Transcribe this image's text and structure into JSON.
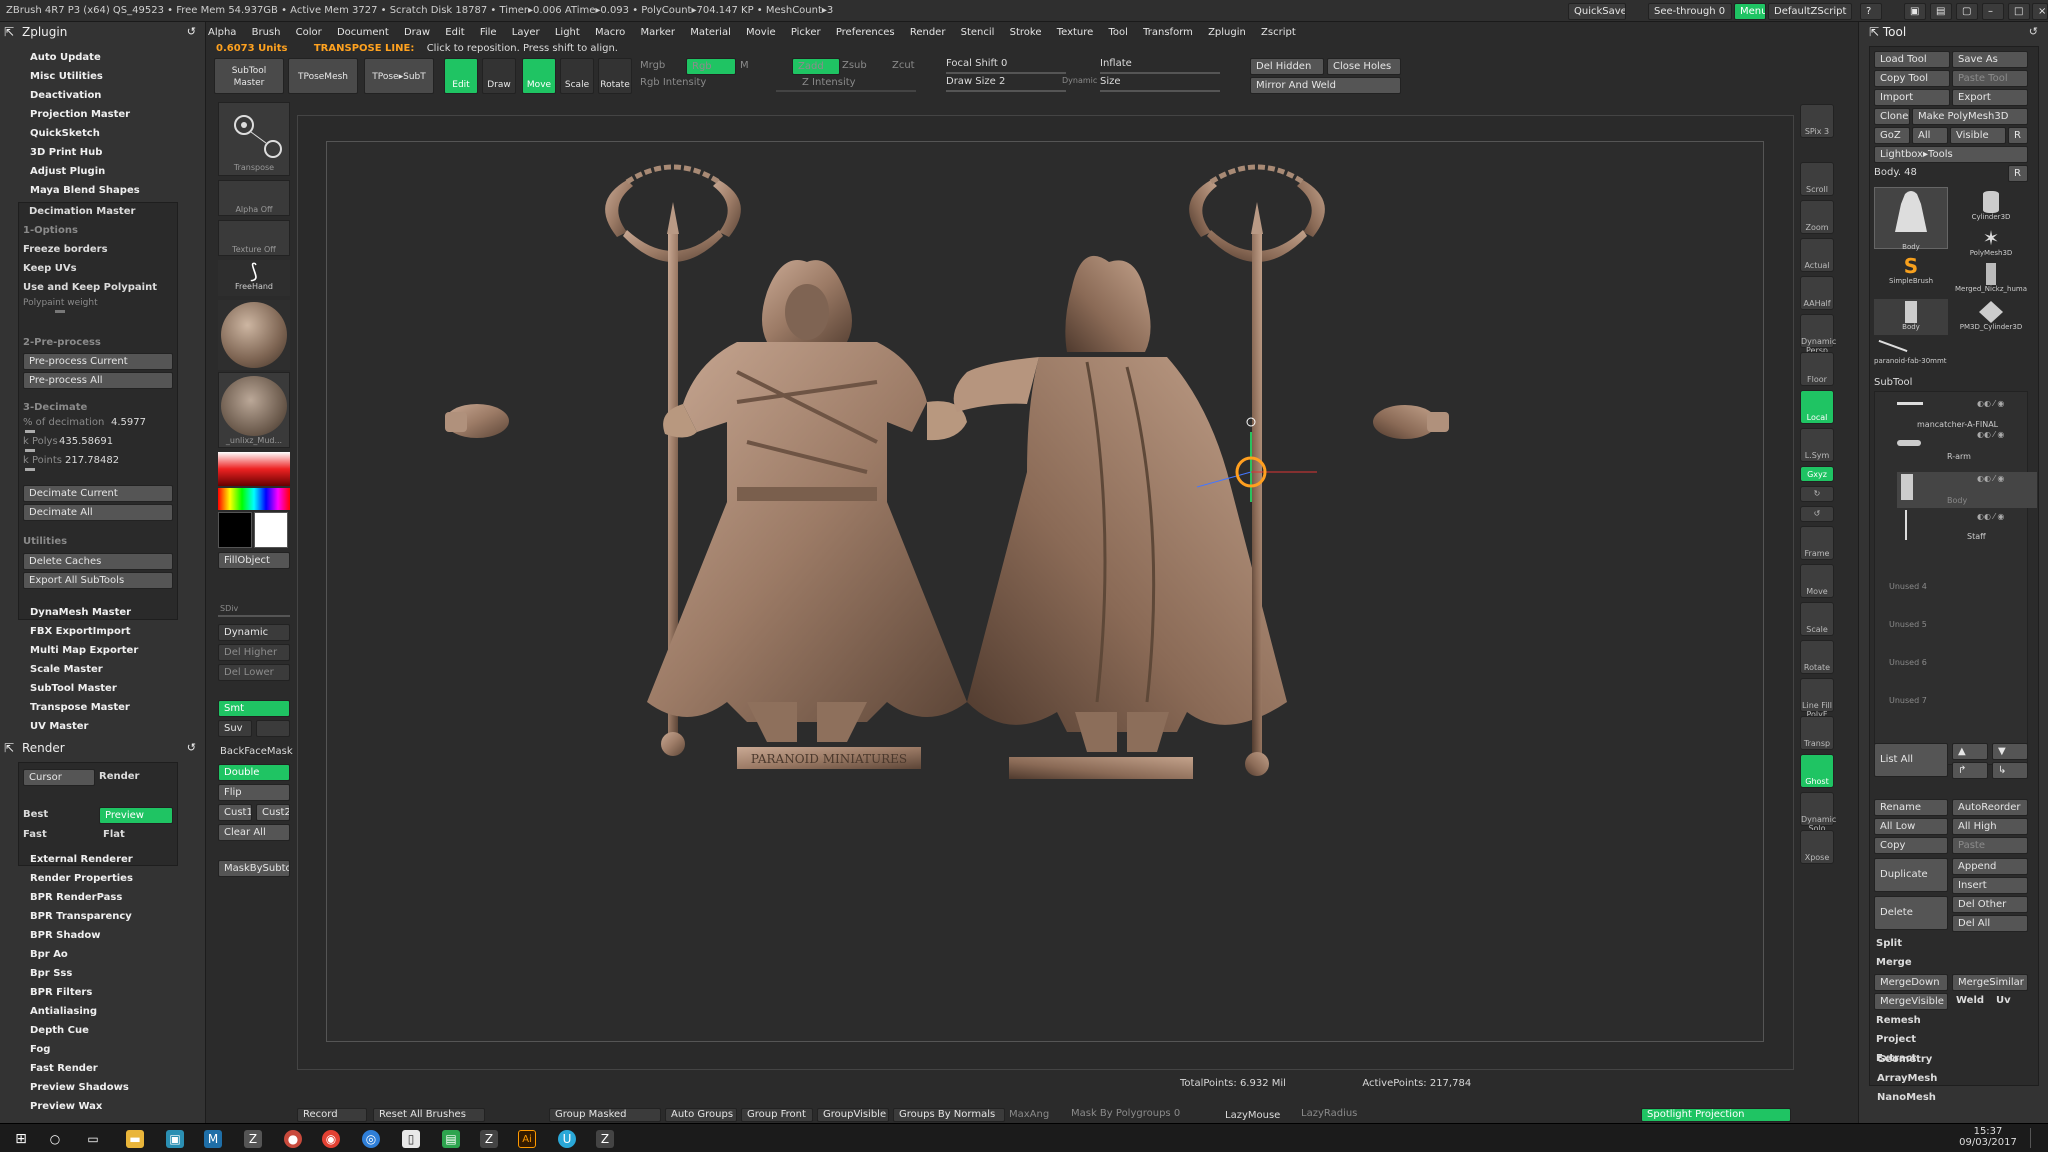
{
  "titlebar": {
    "text": "ZBrush 4R7 P3 (x64)   QS_49523   • Free Mem 54.937GB • Active Mem 3727 • Scratch Disk 18787 • Timer▸0.006 ATime▸0.093 • PolyCount▸704.147 KP • MeshCount▸3",
    "quicksave": "QuickSave",
    "seethrough": "See-through  0",
    "menus": "Menus",
    "defaultzscript": "DefaultZScript"
  },
  "menubar": [
    "Alpha",
    "Brush",
    "Color",
    "Document",
    "Draw",
    "Edit",
    "File",
    "Layer",
    "Light",
    "Macro",
    "Marker",
    "Material",
    "Movie",
    "Picker",
    "Preferences",
    "Render",
    "Stencil",
    "Stroke",
    "Texture",
    "Tool",
    "Transform",
    "Zplugin",
    "Zscript"
  ],
  "status": {
    "units": "0.6073 Units",
    "mode": "TRANSPOSE LINE:",
    "message": "Click to reposition. Press shift to align."
  },
  "left_palette": {
    "title": "Zplugin",
    "items_top": [
      "Auto Update",
      "Misc Utilities",
      "Deactivation",
      "Projection Master",
      "QuickSketch",
      "3D Print Hub",
      "Adjust Plugin",
      "Maya Blend Shapes"
    ],
    "decimation": {
      "title": "Decimation Master",
      "options_label": "1-Options",
      "options": [
        "Freeze borders",
        "Keep UVs",
        "Use and Keep Polypaint"
      ],
      "polypaint_weight": "Polypaint weight",
      "preprocess_label": "2-Pre-process",
      "preprocess_current": "Pre-process Current",
      "preprocess_all": "Pre-process All",
      "decimate_label": "3-Decimate",
      "pct_label": "% of decimation",
      "pct_value": "4.5977",
      "kpolys_label": "k Polys",
      "kpolys_value": "435.58691",
      "kpoints_label": "k Points",
      "kpoints_value": "217.78482",
      "decimate_current": "Decimate Current",
      "decimate_all": "Decimate All",
      "utilities_label": "Utilities",
      "delete_caches": "Delete Caches",
      "export_all": "Export All SubTools"
    },
    "items_bottom": [
      "DynaMesh Master",
      "FBX ExportImport",
      "Multi Map Exporter",
      "Scale Master",
      "SubTool Master",
      "Transpose Master",
      "UV Master"
    ],
    "render_title": "Render",
    "render_panel": {
      "cursor": "Cursor",
      "render": "Render",
      "best": "Best",
      "preview": "Preview",
      "fast": "Fast",
      "flat": "Flat"
    },
    "render_items": [
      "External Renderer",
      "Render Properties",
      "BPR RenderPass",
      "BPR Transparency",
      "BPR Shadow",
      "Bpr Ao",
      "Bpr Sss",
      "BPR Filters",
      "Antialiasing",
      "Depth Cue",
      "Fog",
      "Fast Render",
      "Preview Shadows",
      "Preview Wax"
    ]
  },
  "toolstrip": {
    "subtool_master": "SubTool Master",
    "tpose_mesh": "TPoseMesh",
    "tpose_subt": "TPose▸SubT",
    "edit": "Edit",
    "draw": "Draw",
    "move": "Move",
    "scale": "Scale",
    "rotate": "Rotate",
    "mrgb": "Mrgb",
    "rgb": "Rgb",
    "m": "M",
    "rgb_intensity": "Rgb Intensity",
    "zadd": "Zadd",
    "zsub": "Zsub",
    "zcut": "Zcut",
    "z_intensity": "Z Intensity",
    "focal_shift": "Focal Shift 0",
    "draw_size": "Draw Size 2",
    "dynamic": "Dynamic",
    "inflate": "Inflate",
    "size": "Size",
    "del_hidden": "Del Hidden",
    "close_holes": "Close Holes",
    "mirror_weld": "Mirror And Weld"
  },
  "shelf": {
    "transpose": "Transpose",
    "alpha_off": "Alpha Off",
    "texture_off": "Texture Off",
    "freehand": "FreeHand",
    "material": "_unlixz_Mud...",
    "fillobject": "FillObject",
    "sdiv": "SDiv",
    "dynamic": "Dynamic",
    "del_higher": "Del Higher",
    "del_lower": "Del Lower",
    "smt": "Smt",
    "suv": "Suv",
    "backfacemask": "BackFaceMask",
    "double": "Double",
    "flip": "Flip",
    "cust1": "Cust1",
    "cust2": "Cust2",
    "clear_all": "Clear All",
    "maskbysubtool": "MaskBySubtool"
  },
  "viewport": {
    "base_text": "PARANOID MINIATURES",
    "total_points": "TotalPoints: 6.932 Mil",
    "active_points": "ActivePoints: 217,784"
  },
  "right_shelf": [
    "SPix 3",
    "Scroll",
    "Zoom",
    "Actual",
    "AAHalf",
    "Dynamic Persp",
    "Floor",
    "Local",
    "L.Sym",
    "Gxyz",
    "",
    "",
    "Frame",
    "Move",
    "Scale",
    "Rotate",
    "Line Fill PolyF",
    "Transp",
    "Ghost",
    "Dynamic Solo",
    "Xpose"
  ],
  "right_palette": {
    "title": "Tool",
    "load_tool": "Load Tool",
    "save_as": "Save As",
    "copy_tool": "Copy Tool",
    "paste_tool": "Paste Tool",
    "import": "Import",
    "export": "Export",
    "clone": "Clone",
    "make_polymesh": "Make PolyMesh3D",
    "goz": "GoZ",
    "all": "All",
    "visible": "Visible",
    "r": "R",
    "lightbox_tools": "Lightbox▸Tools",
    "body_slider": "Body. 48",
    "thumbs": [
      "Body",
      "Cylinder3D",
      "PolyMesh3D",
      "SimpleBrush",
      "Merged_Nickz_huma",
      "Body",
      "PM3D_Cylinder3D",
      "paranoid-fab-30mmt"
    ],
    "subtool_title": "SubTool",
    "subtools": [
      "mancatcher-A-FINAL",
      "R-arm",
      "Body",
      "Staff"
    ],
    "unused": [
      "Unused 4",
      "Unused 5",
      "Unused 6",
      "Unused 7"
    ],
    "list_all": "List All",
    "rename": "Rename",
    "autoreorder": "AutoReorder",
    "all_low": "All Low",
    "all_high": "All High",
    "copy": "Copy",
    "paste": "Paste",
    "duplicate": "Duplicate",
    "append": "Append",
    "insert": "Insert",
    "delete": "Delete",
    "del_other": "Del Other",
    "del_all": "Del All",
    "split": "Split",
    "merge": "Merge",
    "mergedown": "MergeDown",
    "mergesimilar": "MergeSimilar",
    "mergevisible": "MergeVisible",
    "weld": "Weld",
    "uv": "Uv",
    "remesh": "Remesh",
    "project": "Project",
    "extract": "Extract",
    "geometry": "Geometry",
    "arraymesh": "ArrayMesh",
    "nanomesh": "NanoMesh"
  },
  "bottombar": {
    "record": "Record",
    "reset_brushes": "Reset All Brushes",
    "group_masked": "Group Masked",
    "auto_groups": "Auto Groups",
    "group_front": "Group Front",
    "group_visible": "GroupVisible",
    "groups_by_normals": "Groups By Normals",
    "maxang": "MaxAng",
    "mask_by_polygroups": "Mask By Polygroups 0",
    "lazymouse": "LazyMouse",
    "lazyradius": "LazyRadius",
    "spotlight": "Spotlight Projection"
  },
  "taskbar": {
    "time": "15:37",
    "date": "09/03/2017"
  },
  "colors": {
    "accent_green": "#1fc463",
    "accent_orange": "#ffa21f",
    "model_bronze": "#a2806a"
  }
}
